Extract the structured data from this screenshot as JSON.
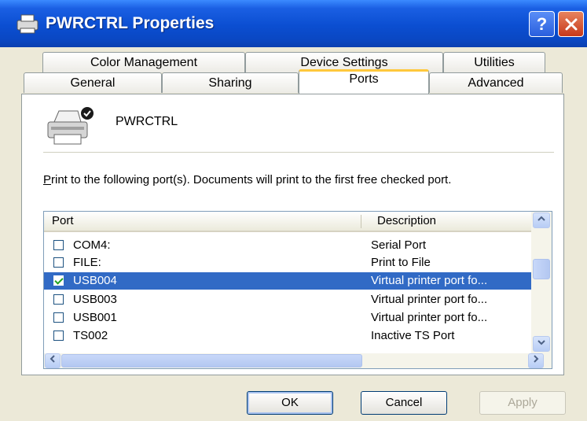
{
  "window": {
    "title": "PWRCTRL Properties"
  },
  "tabs_back": [
    "Color Management",
    "Device Settings",
    "Utilities"
  ],
  "tabs_front": [
    "General",
    "Sharing",
    "Ports",
    "Advanced"
  ],
  "active_tab": "Ports",
  "printer": {
    "name": "PWRCTRL"
  },
  "instructions": {
    "mnemonic": "P",
    "rest": "rint to the following port(s). Documents will print to the first free checked port."
  },
  "list": {
    "headers": {
      "port": "Port",
      "description": "Description"
    },
    "rows": [
      {
        "port": "COM4:",
        "description": "Serial Port",
        "checked": false,
        "selected": false
      },
      {
        "port": "FILE:",
        "description": "Print to File",
        "checked": false,
        "selected": false
      },
      {
        "port": "USB004",
        "description": "Virtual printer port fo...",
        "checked": true,
        "selected": true
      },
      {
        "port": "USB003",
        "description": "Virtual printer port fo...",
        "checked": false,
        "selected": false
      },
      {
        "port": "USB001",
        "description": "Virtual printer port fo...",
        "checked": false,
        "selected": false
      },
      {
        "port": "TS002",
        "description": "Inactive TS Port",
        "checked": false,
        "selected": false
      }
    ]
  },
  "buttons": {
    "ok": "OK",
    "cancel": "Cancel",
    "apply": "Apply"
  }
}
